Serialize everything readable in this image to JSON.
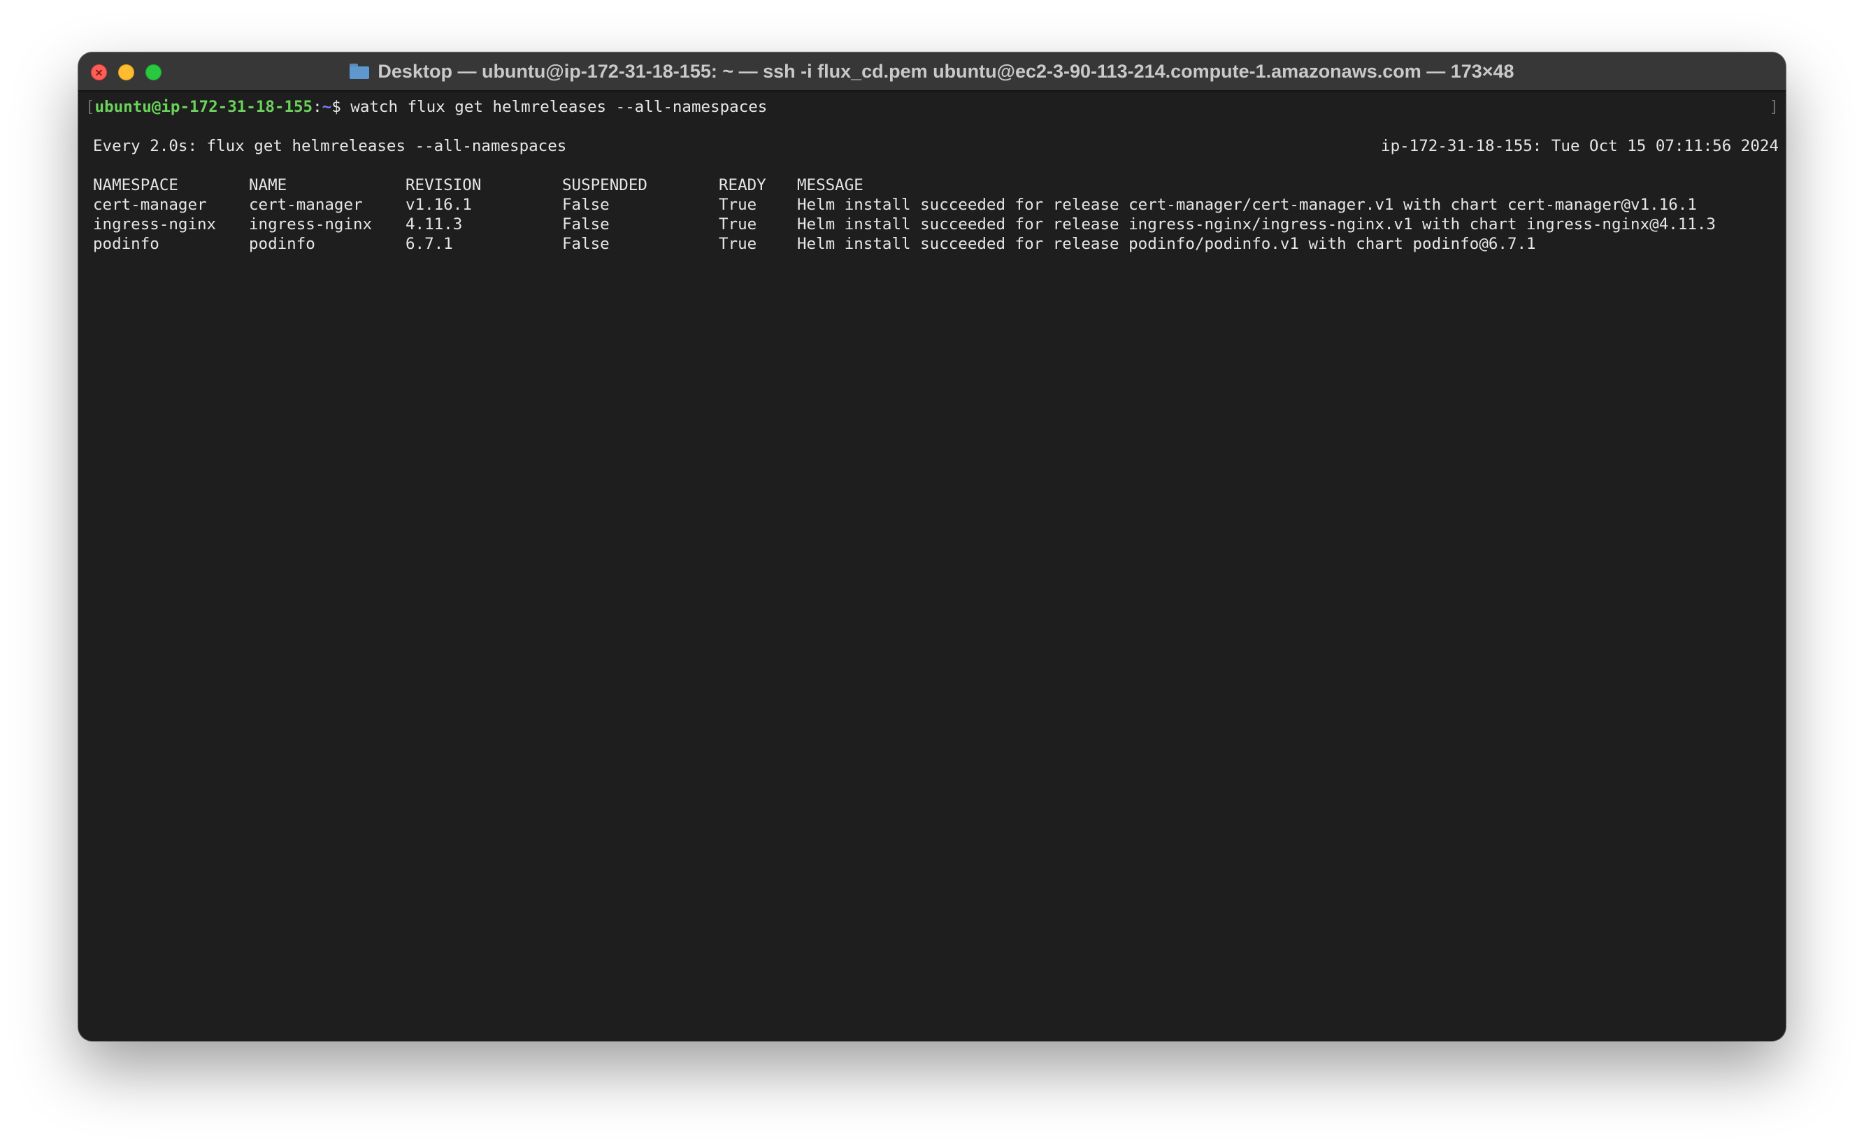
{
  "window": {
    "title": "Desktop — ubuntu@ip-172-31-18-155: ~ — ssh -i flux_cd.pem ubuntu@ec2-3-90-113-214.compute-1.amazonaws.com — 173×48"
  },
  "terminal": {
    "prompt": {
      "open_bracket": "[",
      "user_host": "ubuntu@ip-172-31-18-155",
      "separator": ":",
      "path": "~",
      "symbol": "$",
      "command": "watch flux get helmreleases --all-namespaces",
      "close_bracket": "]"
    },
    "watch_header": {
      "left": "Every 2.0s: flux get helmreleases --all-namespaces",
      "right": "ip-172-31-18-155: Tue Oct 15 07:11:56 2024"
    },
    "table": {
      "columns": [
        "NAMESPACE",
        "NAME",
        "REVISION",
        "SUSPENDED",
        "READY",
        "MESSAGE"
      ],
      "rows": [
        [
          "cert-manager",
          "cert-manager",
          "v1.16.1",
          "False",
          "True",
          "Helm install succeeded for release cert-manager/cert-manager.v1 with chart cert-manager@v1.16.1"
        ],
        [
          "ingress-nginx",
          "ingress-nginx",
          "4.11.3",
          "False",
          "True",
          "Helm install succeeded for release ingress-nginx/ingress-nginx.v1 with chart ingress-nginx@4.11.3"
        ],
        [
          "podinfo",
          "podinfo",
          "6.7.1",
          "False",
          "True",
          "Helm install succeeded for release podinfo/podinfo.v1 with chart podinfo@6.7.1"
        ]
      ]
    }
  }
}
